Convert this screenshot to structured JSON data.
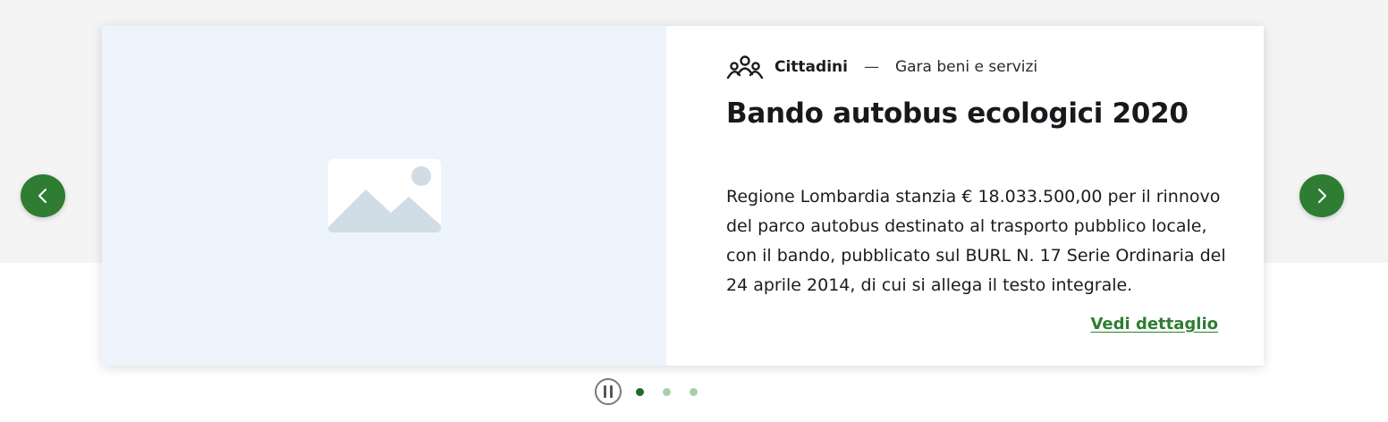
{
  "carousel": {
    "category": "Cittadini",
    "separator": "—",
    "subcategory": "Gara beni e servizi",
    "title": "Bando autobus ecologici 2020",
    "description": "Regione Lombardia stanzia € 18.033.500,00 per il rinnovo del parco autobus destinato al trasporto pubblico locale, con il bando, pubblicato sul BURL N. 17 Serie Ordinaria del 24 aprile 2014, di cui si allega il testo integrale.",
    "link_label": "Vedi dettaglio",
    "slides_total": 3,
    "active_slide": 1
  },
  "icons": {
    "category": "people-group-icon",
    "media": "image-placeholder-icon",
    "prev": "chevron-left-icon",
    "next": "chevron-right-icon",
    "pause": "pause-icon"
  },
  "colors": {
    "accent": "#2e7d32",
    "dot_active": "#1f6b2a",
    "dot_inactive": "#a8cfa9",
    "media_bg": "#eef4fb",
    "band_bg": "#f4f4f4"
  }
}
